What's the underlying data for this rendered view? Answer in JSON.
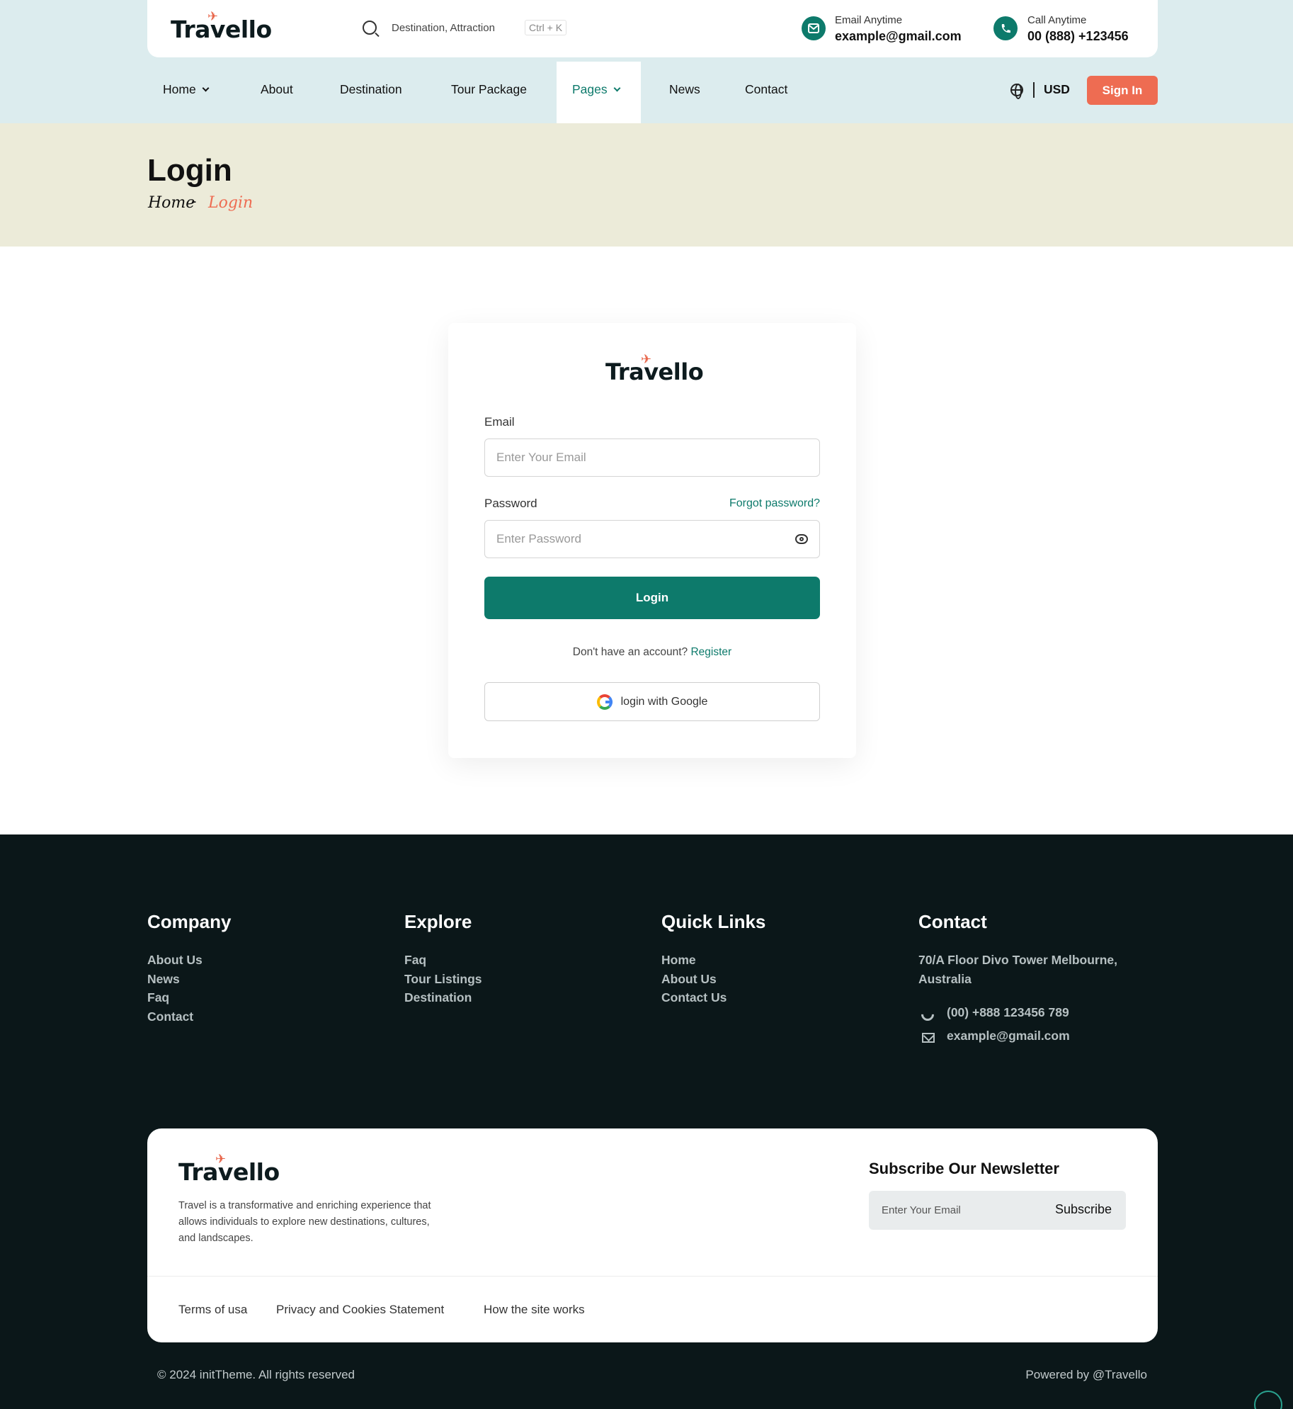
{
  "brand": {
    "name": "Travello",
    "accent": "#ee6c52",
    "primary": "#0d7a6b"
  },
  "topbar": {
    "search_placeholder": "Destination, Attraction",
    "search_shortcut": "Ctrl + K",
    "email_label": "Email Anytime",
    "email_value": "example@gmail.com",
    "call_label": "Call Anytime",
    "call_value": "00 (888) +123456"
  },
  "nav": {
    "items": [
      "Home",
      "About",
      "Destination",
      "Tour Package",
      "Pages",
      "News",
      "Contact"
    ],
    "active": "Pages",
    "currency": "USD",
    "signin": "Sign In"
  },
  "page_header": {
    "title": "Login",
    "breadcrumb": [
      "Home",
      "Login"
    ],
    "separator": "-"
  },
  "login": {
    "email_label": "Email",
    "email_placeholder": "Enter Your Email",
    "password_label": "Password",
    "forgot": "Forgot password?",
    "password_placeholder": "Enter Password",
    "submit": "Login",
    "no_account": "Don't have an account?",
    "register": "Register",
    "google": "login with Google"
  },
  "footer": {
    "company": {
      "title": "Company",
      "links": [
        "About Us",
        "News",
        "Faq",
        "Contact"
      ]
    },
    "explore": {
      "title": "Explore",
      "links": [
        "Faq",
        "Tour Listings",
        "Destination"
      ]
    },
    "quick": {
      "title": "Quick Links",
      "links": [
        "Home",
        "About Us",
        "Contact Us"
      ]
    },
    "contact": {
      "title": "Contact",
      "address_line1": "70/A Floor Divo Tower Melbourne,",
      "address_line2": "Australia",
      "phone": "(00) +888 123456 789",
      "email": "example@gmail.com"
    },
    "about_text": "Travel is a transformative and enriching experience that allows individuals to explore new destinations, cultures, and landscapes.",
    "newsletter_title": "Subscribe Our Newsletter",
    "newsletter_placeholder": "Enter Your Email",
    "newsletter_button": "Subscribe",
    "legal": [
      "Terms of usa",
      "Privacy and Cookies Statement",
      "How the site works"
    ],
    "copyright": "© 2024 initTheme. All rights reserved",
    "powered": "Powered by @Travello"
  }
}
